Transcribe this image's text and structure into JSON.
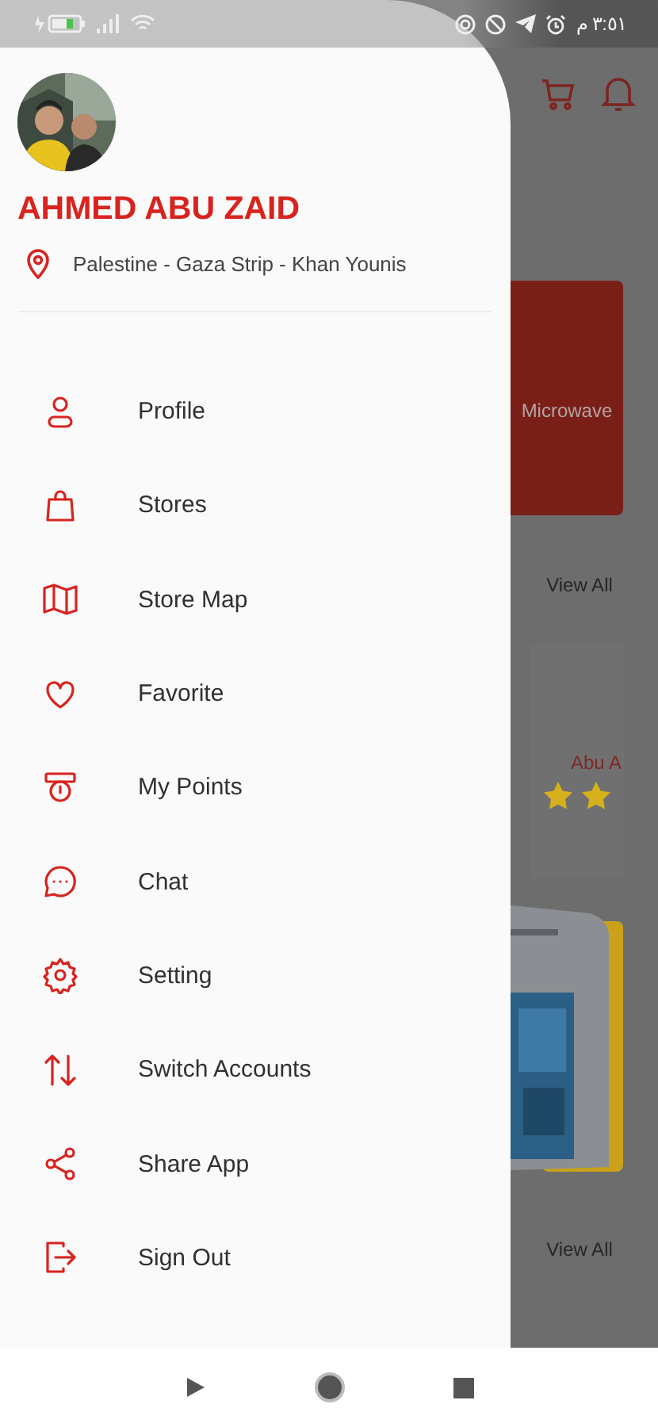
{
  "status_bar": {
    "time": "٣:٥١ م"
  },
  "drawer": {
    "user": {
      "name": "AHMED ABU ZAID",
      "location": "Palestine - Gaza Strip - Khan Younis"
    },
    "items": [
      {
        "label": "Profile"
      },
      {
        "label": "Stores"
      },
      {
        "label": "Store Map"
      },
      {
        "label": "Favorite"
      },
      {
        "label": "My Points"
      },
      {
        "label": "Chat"
      },
      {
        "label": "Setting"
      },
      {
        "label": "Switch Accounts"
      },
      {
        "label": "Share App"
      },
      {
        "label": "Sign Out"
      }
    ]
  },
  "background": {
    "category_card": "Microwave",
    "view_all": [
      "View All",
      "View All"
    ],
    "store_card": {
      "name": "Abu A"
    }
  }
}
